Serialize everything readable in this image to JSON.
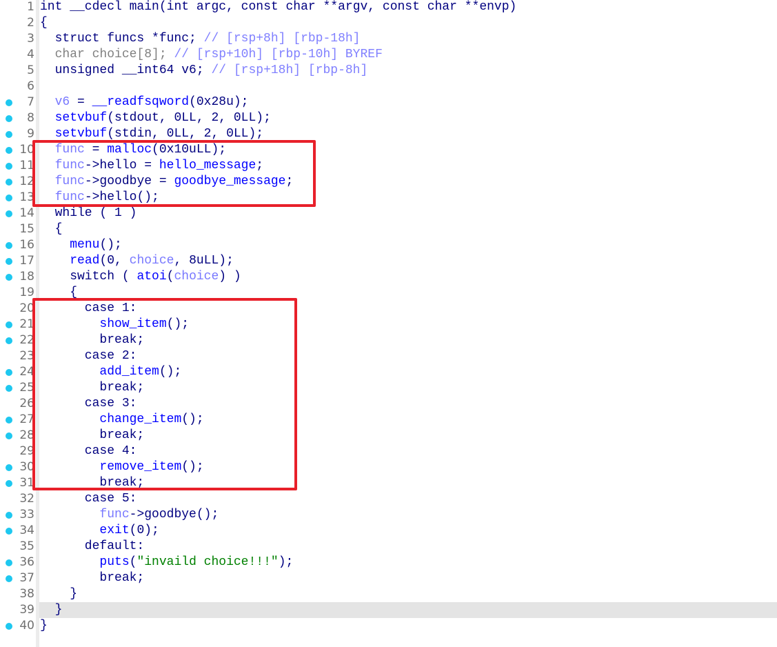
{
  "colors": {
    "default": "#000080",
    "function": "#0000ff",
    "variable": "#7878ff",
    "comment": "#8080ff",
    "unused": "#808080",
    "string": "#008000",
    "breakpoint_dot": "#1ec8f0",
    "highlight_box": "#e8202a",
    "current_line": "#e4e4e4"
  },
  "highlighted_line": 39,
  "lines": [
    {
      "n": "1",
      "dot": false,
      "t": [
        [
          "int __cdecl ",
          "n"
        ],
        [
          "main",
          "n"
        ],
        [
          "(int argc, const char **argv, const char **envp)",
          "n"
        ]
      ]
    },
    {
      "n": "2",
      "dot": false,
      "t": [
        [
          "{",
          "n"
        ]
      ]
    },
    {
      "n": "3",
      "dot": false,
      "t": [
        [
          "  struct funcs *func; ",
          "n"
        ],
        [
          "// [rsp+8h] [rbp-18h]",
          "c"
        ]
      ]
    },
    {
      "n": "4",
      "dot": false,
      "t": [
        [
          "  char choice[8]; ",
          "g"
        ],
        [
          "// [rsp+10h] [rbp-10h] BYREF",
          "c"
        ]
      ]
    },
    {
      "n": "5",
      "dot": false,
      "t": [
        [
          "  unsigned __int64 v6; ",
          "n"
        ],
        [
          "// [rsp+18h] [rbp-8h]",
          "c"
        ]
      ]
    },
    {
      "n": "6",
      "dot": false,
      "t": []
    },
    {
      "n": "7",
      "dot": true,
      "t": [
        [
          "  ",
          "n"
        ],
        [
          "v6",
          "v"
        ],
        [
          " = ",
          "n"
        ],
        [
          "__readfsqword",
          "f"
        ],
        [
          "(0x28u);",
          "n"
        ]
      ]
    },
    {
      "n": "8",
      "dot": true,
      "t": [
        [
          "  ",
          "n"
        ],
        [
          "setvbuf",
          "f"
        ],
        [
          "(stdout, 0LL, 2, 0LL);",
          "n"
        ]
      ]
    },
    {
      "n": "9",
      "dot": true,
      "t": [
        [
          "  ",
          "n"
        ],
        [
          "setvbuf",
          "f"
        ],
        [
          "(stdin, 0LL, 2, 0LL);",
          "n"
        ]
      ]
    },
    {
      "n": "10",
      "dot": true,
      "t": [
        [
          "  ",
          "n"
        ],
        [
          "func",
          "v"
        ],
        [
          " = ",
          "n"
        ],
        [
          "malloc",
          "f"
        ],
        [
          "(0x10uLL);",
          "n"
        ]
      ]
    },
    {
      "n": "11",
      "dot": true,
      "t": [
        [
          "  ",
          "n"
        ],
        [
          "func",
          "v"
        ],
        [
          "->hello = ",
          "n"
        ],
        [
          "hello_message",
          "f"
        ],
        [
          ";",
          "n"
        ]
      ]
    },
    {
      "n": "12",
      "dot": true,
      "t": [
        [
          "  ",
          "n"
        ],
        [
          "func",
          "v"
        ],
        [
          "->goodbye = ",
          "n"
        ],
        [
          "goodbye_message",
          "f"
        ],
        [
          ";",
          "n"
        ]
      ]
    },
    {
      "n": "13",
      "dot": true,
      "t": [
        [
          "  ",
          "n"
        ],
        [
          "func",
          "v"
        ],
        [
          "->hello();",
          "n"
        ]
      ]
    },
    {
      "n": "14",
      "dot": true,
      "t": [
        [
          "  while ( 1 )",
          "n"
        ]
      ]
    },
    {
      "n": "15",
      "dot": false,
      "t": [
        [
          "  {",
          "n"
        ]
      ]
    },
    {
      "n": "16",
      "dot": true,
      "t": [
        [
          "    ",
          "n"
        ],
        [
          "menu",
          "f"
        ],
        [
          "();",
          "n"
        ]
      ]
    },
    {
      "n": "17",
      "dot": true,
      "t": [
        [
          "    ",
          "n"
        ],
        [
          "read",
          "f"
        ],
        [
          "(0, ",
          "n"
        ],
        [
          "choice",
          "v"
        ],
        [
          ", 8uLL);",
          "n"
        ]
      ]
    },
    {
      "n": "18",
      "dot": true,
      "t": [
        [
          "    switch ( ",
          "n"
        ],
        [
          "atoi",
          "f"
        ],
        [
          "(",
          "n"
        ],
        [
          "choice",
          "v"
        ],
        [
          ") )",
          "n"
        ]
      ]
    },
    {
      "n": "19",
      "dot": false,
      "t": [
        [
          "    {",
          "n"
        ]
      ]
    },
    {
      "n": "20",
      "dot": false,
      "t": [
        [
          "      case 1:",
          "n"
        ]
      ]
    },
    {
      "n": "21",
      "dot": true,
      "t": [
        [
          "        ",
          "n"
        ],
        [
          "show_item",
          "f"
        ],
        [
          "();",
          "n"
        ]
      ]
    },
    {
      "n": "22",
      "dot": true,
      "t": [
        [
          "        break;",
          "n"
        ]
      ]
    },
    {
      "n": "23",
      "dot": false,
      "t": [
        [
          "      case 2:",
          "n"
        ]
      ]
    },
    {
      "n": "24",
      "dot": true,
      "t": [
        [
          "        ",
          "n"
        ],
        [
          "add_item",
          "f"
        ],
        [
          "();",
          "n"
        ]
      ]
    },
    {
      "n": "25",
      "dot": true,
      "t": [
        [
          "        break;",
          "n"
        ]
      ]
    },
    {
      "n": "26",
      "dot": false,
      "t": [
        [
          "      case 3:",
          "n"
        ]
      ]
    },
    {
      "n": "27",
      "dot": true,
      "t": [
        [
          "        ",
          "n"
        ],
        [
          "change_item",
          "f"
        ],
        [
          "();",
          "n"
        ]
      ]
    },
    {
      "n": "28",
      "dot": true,
      "t": [
        [
          "        break;",
          "n"
        ]
      ]
    },
    {
      "n": "29",
      "dot": false,
      "t": [
        [
          "      case 4:",
          "n"
        ]
      ]
    },
    {
      "n": "30",
      "dot": true,
      "t": [
        [
          "        ",
          "n"
        ],
        [
          "remove_item",
          "f"
        ],
        [
          "();",
          "n"
        ]
      ]
    },
    {
      "n": "31",
      "dot": true,
      "t": [
        [
          "        break;",
          "n"
        ]
      ]
    },
    {
      "n": "32",
      "dot": false,
      "t": [
        [
          "      case 5:",
          "n"
        ]
      ]
    },
    {
      "n": "33",
      "dot": true,
      "t": [
        [
          "        ",
          "n"
        ],
        [
          "func",
          "v"
        ],
        [
          "->goodbye();",
          "n"
        ]
      ]
    },
    {
      "n": "34",
      "dot": true,
      "t": [
        [
          "        ",
          "n"
        ],
        [
          "exit",
          "f"
        ],
        [
          "(0);",
          "n"
        ]
      ]
    },
    {
      "n": "35",
      "dot": false,
      "t": [
        [
          "      default:",
          "n"
        ]
      ]
    },
    {
      "n": "36",
      "dot": true,
      "t": [
        [
          "        ",
          "n"
        ],
        [
          "puts",
          "f"
        ],
        [
          "(",
          "n"
        ],
        [
          "\"invaild choice!!!\"",
          "s"
        ],
        [
          ");",
          "n"
        ]
      ]
    },
    {
      "n": "37",
      "dot": true,
      "t": [
        [
          "        break;",
          "n"
        ]
      ]
    },
    {
      "n": "38",
      "dot": false,
      "t": [
        [
          "    }",
          "n"
        ]
      ]
    },
    {
      "n": "39",
      "dot": false,
      "t": [
        [
          "  }",
          "n"
        ]
      ]
    },
    {
      "n": "40",
      "dot": true,
      "t": [
        [
          "}",
          "n"
        ]
      ]
    }
  ]
}
